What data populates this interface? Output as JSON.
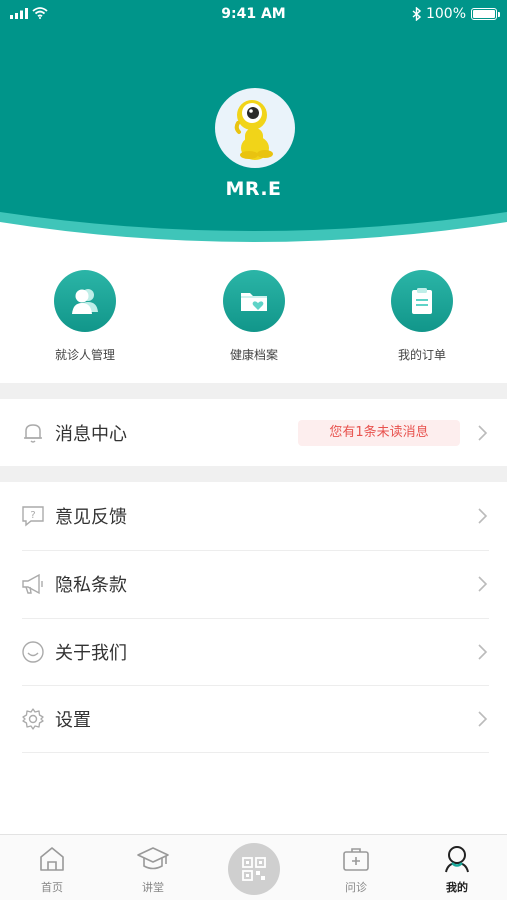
{
  "status_bar": {
    "time": "9:41 AM",
    "battery": "100%"
  },
  "profile": {
    "username": "MR.E"
  },
  "shortcuts": [
    {
      "label": "就诊人管理",
      "icon": "users-icon"
    },
    {
      "label": "健康档案",
      "icon": "health-folder-icon"
    },
    {
      "label": "我的订单",
      "icon": "order-clipboard-icon"
    }
  ],
  "message_center": {
    "label": "消息中心",
    "badge": "您有1条未读消息"
  },
  "menu": [
    {
      "label": "意见反馈",
      "icon": "feedback-icon"
    },
    {
      "label": "隐私条款",
      "icon": "megaphone-icon"
    },
    {
      "label": "关于我们",
      "icon": "smile-icon"
    },
    {
      "label": "设置",
      "icon": "gear-icon"
    }
  ],
  "tabbar": [
    {
      "label": "首页",
      "icon": "home-icon"
    },
    {
      "label": "讲堂",
      "icon": "graduation-cap-icon"
    },
    {
      "label": "",
      "icon": "qr-scan-icon"
    },
    {
      "label": "问诊",
      "icon": "medical-kit-icon"
    },
    {
      "label": "我的",
      "icon": "profile-icon"
    }
  ],
  "colors": {
    "header_teal": "#00958a",
    "accent": "#1aa89b",
    "badge_text": "#e8524e",
    "badge_bg": "#fdeeee"
  }
}
